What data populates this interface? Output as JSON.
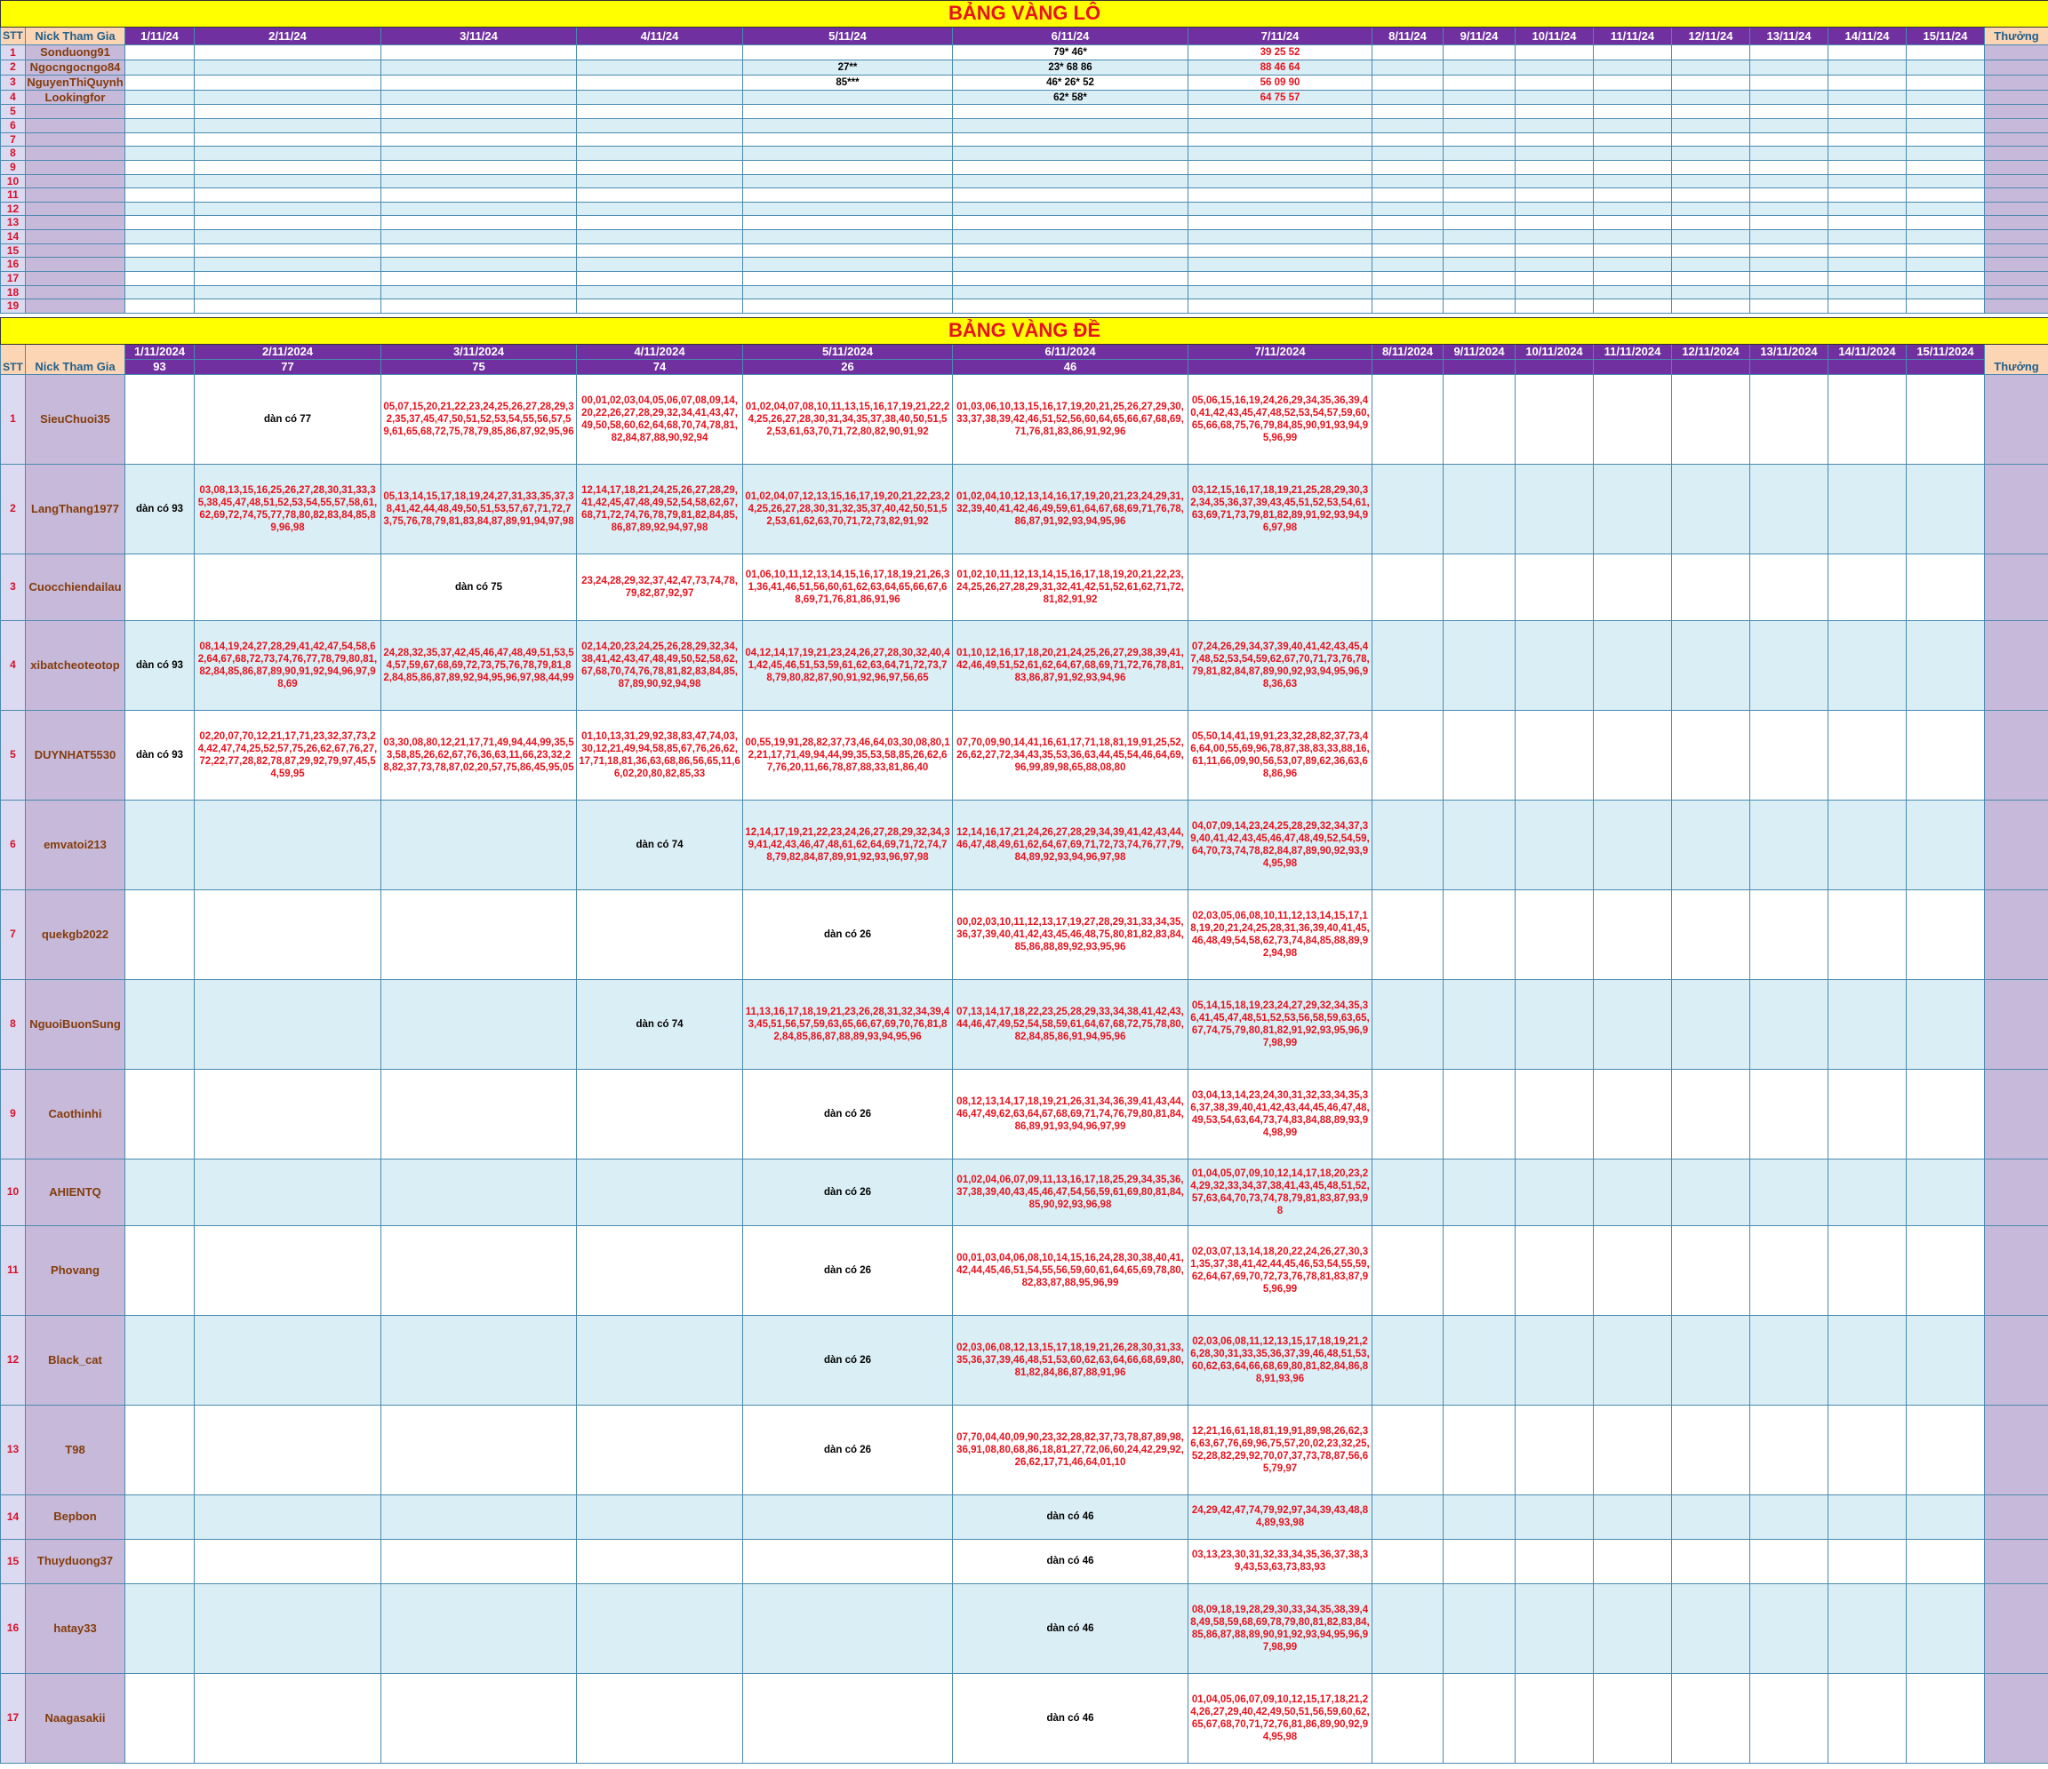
{
  "lo": {
    "title": "BẢNG VÀNG LÔ",
    "headers": [
      "STT",
      "Nick Tham Gia",
      "1/11/24",
      "2/11/24",
      "3/11/24",
      "4/11/24",
      "5/11/24",
      "6/11/24",
      "7/11/24",
      "8/11/24",
      "9/11/24",
      "10/11/24",
      "11/11/24",
      "12/11/24",
      "13/11/24",
      "14/11/24",
      "15/11/24",
      "Thưởng"
    ],
    "rows": [
      {
        "stt": "1",
        "nick": "Sonduong91",
        "cells": [
          "",
          "",
          "",
          "",
          "",
          "79* 46*",
          "39 25 52",
          "",
          "",
          "",
          "",
          "",
          "",
          "",
          ""
        ]
      },
      {
        "stt": "2",
        "nick": "Ngocngocngo84",
        "cells": [
          "",
          "",
          "",
          "",
          "27**",
          "23* 68 86",
          "88 46 64",
          "",
          "",
          "",
          "",
          "",
          "",
          "",
          ""
        ]
      },
      {
        "stt": "3",
        "nick": "NguyenThiQuynh",
        "cells": [
          "",
          "",
          "",
          "",
          "85***",
          "46* 26* 52",
          "56 09 90",
          "",
          "",
          "",
          "",
          "",
          "",
          "",
          ""
        ]
      },
      {
        "stt": "4",
        "nick": "Lookingfor",
        "cells": [
          "",
          "",
          "",
          "",
          "",
          "62* 58*",
          "64 75 57",
          "",
          "",
          "",
          "",
          "",
          "",
          "",
          ""
        ]
      },
      {
        "stt": "5",
        "nick": "",
        "cells": [
          "",
          "",
          "",
          "",
          "",
          "",
          "",
          "",
          "",
          "",
          "",
          "",
          "",
          "",
          ""
        ]
      },
      {
        "stt": "6",
        "nick": "",
        "cells": [
          "",
          "",
          "",
          "",
          "",
          "",
          "",
          "",
          "",
          "",
          "",
          "",
          "",
          "",
          ""
        ]
      },
      {
        "stt": "7",
        "nick": "",
        "cells": [
          "",
          "",
          "",
          "",
          "",
          "",
          "",
          "",
          "",
          "",
          "",
          "",
          "",
          "",
          ""
        ]
      },
      {
        "stt": "8",
        "nick": "",
        "cells": [
          "",
          "",
          "",
          "",
          "",
          "",
          "",
          "",
          "",
          "",
          "",
          "",
          "",
          "",
          ""
        ]
      },
      {
        "stt": "9",
        "nick": "",
        "cells": [
          "",
          "",
          "",
          "",
          "",
          "",
          "",
          "",
          "",
          "",
          "",
          "",
          "",
          "",
          ""
        ]
      },
      {
        "stt": "10",
        "nick": "",
        "cells": [
          "",
          "",
          "",
          "",
          "",
          "",
          "",
          "",
          "",
          "",
          "",
          "",
          "",
          "",
          ""
        ]
      },
      {
        "stt": "11",
        "nick": "",
        "cells": [
          "",
          "",
          "",
          "",
          "",
          "",
          "",
          "",
          "",
          "",
          "",
          "",
          "",
          "",
          ""
        ]
      },
      {
        "stt": "12",
        "nick": "",
        "cells": [
          "",
          "",
          "",
          "",
          "",
          "",
          "",
          "",
          "",
          "",
          "",
          "",
          "",
          "",
          ""
        ]
      },
      {
        "stt": "13",
        "nick": "",
        "cells": [
          "",
          "",
          "",
          "",
          "",
          "",
          "",
          "",
          "",
          "",
          "",
          "",
          "",
          "",
          ""
        ]
      },
      {
        "stt": "14",
        "nick": "",
        "cells": [
          "",
          "",
          "",
          "",
          "",
          "",
          "",
          "",
          "",
          "",
          "",
          "",
          "",
          "",
          ""
        ]
      },
      {
        "stt": "15",
        "nick": "",
        "cells": [
          "",
          "",
          "",
          "",
          "",
          "",
          "",
          "",
          "",
          "",
          "",
          "",
          "",
          "",
          ""
        ]
      },
      {
        "stt": "16",
        "nick": "",
        "cells": [
          "",
          "",
          "",
          "",
          "",
          "",
          "",
          "",
          "",
          "",
          "",
          "",
          "",
          "",
          ""
        ]
      },
      {
        "stt": "17",
        "nick": "",
        "cells": [
          "",
          "",
          "",
          "",
          "",
          "",
          "",
          "",
          "",
          "",
          "",
          "",
          "",
          "",
          ""
        ]
      },
      {
        "stt": "18",
        "nick": "",
        "cells": [
          "",
          "",
          "",
          "",
          "",
          "",
          "",
          "",
          "",
          "",
          "",
          "",
          "",
          "",
          ""
        ]
      },
      {
        "stt": "19",
        "nick": "",
        "cells": [
          "",
          "",
          "",
          "",
          "",
          "",
          "",
          "",
          "",
          "",
          "",
          "",
          "",
          "",
          ""
        ]
      }
    ]
  },
  "de": {
    "title": "BẢNG VÀNG ĐỀ",
    "dates": [
      "1/11/2024",
      "2/11/2024",
      "3/11/2024",
      "4/11/2024",
      "5/11/2024",
      "6/11/2024",
      "7/11/2024",
      "8/11/2024",
      "9/11/2024",
      "10/11/2024",
      "11/11/2024",
      "12/11/2024",
      "13/11/2024",
      "14/11/2024",
      "15/11/2024"
    ],
    "results": [
      "93",
      "77",
      "75",
      "74",
      "26",
      "46",
      "",
      "",
      "",
      "",
      "",
      "",
      "",
      "",
      ""
    ],
    "stt_label": "STT",
    "nick_label": "Nick Tham Gia",
    "thuong_label": "Thưởng",
    "rows": [
      {
        "stt": "1",
        "nick": "SieuChuoi35",
        "cells": [
          "",
          "dàn có 77",
          "05,07,15,20,21,22,23,24,25,26,27,28,29,32,35,37,45,47,50,51,52,53,54,55,56,57,59,61,65,68,72,75,78,79,85,86,87,92,95,96",
          "00,01,02,03,04,05,06,07,08,09,14,20,22,26,27,28,29,32,34,41,43,47,49,50,58,60,62,64,68,70,74,78,81,82,84,87,88,90,92,94",
          "01,02,04,07,08,10,11,13,15,16,17,19,21,22,24,25,26,27,28,30,31,34,35,37,38,40,50,51,52,53,61,63,70,71,72,80,82,90,91,92",
          "01,03,06,10,13,15,16,17,19,20,21,25,26,27,29,30,33,37,38,39,42,46,51,52,56,60,64,65,66,67,68,69,71,76,81,83,86,91,92,96",
          "05,06,15,16,19,24,26,29,34,35,36,39,40,41,42,43,45,47,48,52,53,54,57,59,60,65,66,68,75,76,79,84,85,90,91,93,94,95,96,99",
          "",
          "",
          "",
          "",
          "",
          "",
          "",
          ""
        ]
      },
      {
        "stt": "2",
        "nick": "LangThang1977",
        "cells": [
          "dàn có 93",
          "03,08,13,15,16,25,26,27,28,30,31,33,35,38,45,47,48,51,52,53,54,55,57,58,61,62,69,72,74,75,77,78,80,82,83,84,85,89,96,98",
          "05,13,14,15,17,18,19,24,27,31,33,35,37,38,41,42,44,48,49,50,51,53,57,67,71,72,73,75,76,78,79,81,83,84,87,89,91,94,97,98",
          "12,14,17,18,21,24,25,26,27,28,29,41,42,45,47,48,49,52,54,58,62,67,68,71,72,74,76,78,79,81,82,84,85,86,87,89,92,94,97,98",
          "01,02,04,07,12,13,15,16,17,19,20,21,22,23,24,25,26,27,28,30,31,32,35,37,40,42,50,51,52,53,61,62,63,70,71,72,73,82,91,92",
          "01,02,04,10,12,13,14,16,17,19,20,21,23,24,29,31,32,39,40,41,42,46,49,59,61,64,67,68,69,71,76,78,86,87,91,92,93,94,95,96",
          "03,12,15,16,17,18,19,21,25,28,29,30,32,34,35,36,37,39,43,45,51,52,53,54,61,63,69,71,73,79,81,82,89,91,92,93,94,96,97,98",
          "",
          "",
          "",
          "",
          "",
          "",
          "",
          ""
        ]
      },
      {
        "stt": "3",
        "nick": "Cuocchiendailau",
        "cells": [
          "",
          "",
          "dàn có 75",
          "23,24,28,29,32,37,42,47,73,74,78,79,82,87,92,97",
          "01,06,10,11,12,13,14,15,16,17,18,19,21,26,31,36,41,46,51,56,60,61,62,63,64,65,66,67,68,69,71,76,81,86,91,96",
          "01,02,10,11,12,13,14,15,16,17,18,19,20,21,22,23,24,25,26,27,28,29,31,32,41,42,51,52,61,62,71,72,81,82,91,92",
          "",
          "",
          "",
          "",
          "",
          "",
          "",
          "",
          ""
        ]
      },
      {
        "stt": "4",
        "nick": "xibatcheoteotop",
        "cells": [
          "dàn có 93",
          "08,14,19,24,27,28,29,41,42,47,54,58,62,64,67,68,72,73,74,76,77,78,79,80,81,82,84,85,86,87,89,90,91,92,94,96,97,98,69",
          "24,28,32,35,37,42,45,46,47,48,49,51,53,54,57,59,67,68,69,72,73,75,76,78,79,81,82,84,85,86,87,89,92,94,95,96,97,98,44,99",
          "02,14,20,23,24,25,26,28,29,32,34,38,41,42,43,47,48,49,50,52,58,62,67,68,70,74,76,78,81,82,83,84,85,87,89,90,92,94,98",
          "04,12,14,17,19,21,23,24,26,27,28,30,32,40,41,42,45,46,51,53,59,61,62,63,64,71,72,73,78,79,80,82,87,90,91,92,96,97,56,65",
          "01,10,12,16,17,18,20,21,24,25,26,27,29,38,39,41,42,46,49,51,52,61,62,64,67,68,69,71,72,76,78,81,83,86,87,91,92,93,94,96",
          "07,24,26,29,34,37,39,40,41,42,43,45,47,48,52,53,54,59,62,67,70,71,73,76,78,79,81,82,84,87,89,90,92,93,94,95,96,98,36,63",
          "",
          "",
          "",
          "",
          "",
          "",
          "",
          ""
        ]
      },
      {
        "stt": "5",
        "nick": "DUYNHAT5530",
        "cells": [
          "dàn có 93",
          "02,20,07,70,12,21,17,71,23,32,37,73,24,42,47,74,25,52,57,75,26,62,67,76,27,72,22,77,28,82,78,87,29,92,79,97,45,54,59,95",
          "03,30,08,80,12,21,17,71,49,94,44,99,35,53,58,85,26,62,67,76,36,63,11,66,23,32,28,82,37,73,78,87,02,20,57,75,86,45,95,05",
          "01,10,13,31,29,92,38,83,47,74,03,30,12,21,49,94,58,85,67,76,26,62,17,71,18,81,36,63,68,86,56,65,11,66,02,20,80,82,85,33",
          "00,55,19,91,28,82,37,73,46,64,03,30,08,80,12,21,17,71,49,94,44,99,35,53,58,85,26,62,67,76,20,11,66,78,87,88,33,81,86,40",
          "07,70,09,90,14,41,16,61,17,71,18,81,19,91,25,52,26,62,27,72,34,43,35,53,36,63,44,45,54,46,64,69,96,99,89,98,65,88,08,80",
          "05,50,14,41,19,91,23,32,28,82,37,73,46,64,00,55,69,96,78,87,38,83,33,88,16,61,11,66,09,90,56,53,07,89,62,36,63,68,86,96",
          "",
          "",
          "",
          "",
          "",
          "",
          "",
          ""
        ]
      },
      {
        "stt": "6",
        "nick": "emvatoi213",
        "cells": [
          "",
          "",
          "",
          "dàn có 74",
          "12,14,17,19,21,22,23,24,26,27,28,29,32,34,39,41,42,43,46,47,48,61,62,64,69,71,72,74,78,79,82,84,87,89,91,92,93,96,97,98",
          "12,14,16,17,21,24,26,27,28,29,34,39,41,42,43,44,46,47,48,49,61,62,64,67,69,71,72,73,74,76,77,79,84,89,92,93,94,96,97,98",
          "04,07,09,14,23,24,25,28,29,32,34,37,39,40,41,42,43,45,46,47,48,49,52,54,59,64,70,73,74,78,82,84,87,89,90,92,93,94,95,98",
          "",
          "",
          "",
          "",
          "",
          "",
          "",
          ""
        ]
      },
      {
        "stt": "7",
        "nick": "quekgb2022",
        "cells": [
          "",
          "",
          "",
          "",
          "dàn có 26",
          "00,02,03,10,11,12,13,17,19,27,28,29,31,33,34,35,36,37,39,40,41,42,43,45,46,48,75,80,81,82,83,84,85,86,88,89,92,93,95,96",
          "02,03,05,06,08,10,11,12,13,14,15,17,18,19,20,21,24,25,28,31,36,39,40,41,45,46,48,49,54,58,62,73,74,84,85,88,89,92,94,98",
          "",
          "",
          "",
          "",
          "",
          "",
          "",
          ""
        ]
      },
      {
        "stt": "8",
        "nick": "NguoiBuonSung",
        "cells": [
          "",
          "",
          "",
          "dàn có 74",
          "11,13,16,17,18,19,21,23,26,28,31,32,34,39,43,45,51,56,57,59,63,65,66,67,69,70,76,81,82,84,85,86,87,88,89,93,94,95,96",
          "07,13,14,17,18,22,23,25,28,29,33,34,38,41,42,43,44,46,47,49,52,54,58,59,61,64,67,68,72,75,78,80,82,84,85,86,91,94,95,96",
          "05,14,15,18,19,23,24,27,29,32,34,35,36,41,45,47,48,51,52,53,56,58,59,63,65,67,74,75,79,80,81,82,91,92,93,95,96,97,98,99",
          "",
          "",
          "",
          "",
          "",
          "",
          "",
          ""
        ]
      },
      {
        "stt": "9",
        "nick": "Caothinhi",
        "cells": [
          "",
          "",
          "",
          "",
          "dàn có 26",
          "08,12,13,14,17,18,19,21,26,31,34,36,39,41,43,44,46,47,49,62,63,64,67,68,69,71,74,76,79,80,81,84,86,89,91,93,94,96,97,99",
          "03,04,13,14,23,24,30,31,32,33,34,35,36,37,38,39,40,41,42,43,44,45,46,47,48,49,53,54,63,64,73,74,83,84,88,89,93,94,98,99",
          "",
          "",
          "",
          "",
          "",
          "",
          "",
          ""
        ]
      },
      {
        "stt": "10",
        "nick": "AHIENTQ",
        "cells": [
          "",
          "",
          "",
          "",
          "dàn có 26",
          "01,02,04,06,07,09,11,13,16,17,18,25,29,34,35,36,37,38,39,40,43,45,46,47,54,56,59,61,69,80,81,84,85,90,92,93,96,98",
          "01,04,05,07,09,10,12,14,17,18,20,23,24,29,32,33,34,37,38,41,43,45,48,51,52,57,63,64,70,73,74,78,79,81,83,87,93,98",
          "",
          "",
          "",
          "",
          "",
          "",
          "",
          ""
        ]
      },
      {
        "stt": "11",
        "nick": "Phovang",
        "cells": [
          "",
          "",
          "",
          "",
          "dàn có 26",
          "00,01,03,04,06,08,10,14,15,16,24,28,30,38,40,41,42,44,45,46,51,54,55,56,59,60,61,64,65,69,78,80,82,83,87,88,95,96,99",
          "02,03,07,13,14,18,20,22,24,26,27,30,31,35,37,38,41,42,44,45,46,53,54,55,59,62,64,67,69,70,72,73,76,78,81,83,87,95,96,99",
          "",
          "",
          "",
          "",
          "",
          "",
          "",
          ""
        ]
      },
      {
        "stt": "12",
        "nick": "Black_cat",
        "cells": [
          "",
          "",
          "",
          "",
          "dàn có 26",
          "02,03,06,08,12,13,15,17,18,19,21,26,28,30,31,33,35,36,37,39,46,48,51,53,60,62,63,64,66,68,69,80,81,82,84,86,87,88,91,96",
          "02,03,06,08,11,12,13,15,17,18,19,21,26,28,30,31,33,35,36,37,39,46,48,51,53,60,62,63,64,66,68,69,80,81,82,84,86,88,91,93,96",
          "",
          "",
          "",
          "",
          "",
          "",
          "",
          ""
        ]
      },
      {
        "stt": "13",
        "nick": "T98",
        "cells": [
          "",
          "",
          "",
          "",
          "dàn có 26",
          "07,70,04,40,09,90,23,32,28,82,37,73,78,87,89,98,36,91,08,80,68,86,18,81,27,72,06,60,24,42,29,92,26,62,17,71,46,64,01,10",
          "12,21,16,61,18,81,19,91,89,98,26,62,36,63,67,76,69,96,75,57,20,02,23,32,25,52,28,82,29,92,70,07,37,73,78,87,56,65,79,97",
          "",
          "",
          "",
          "",
          "",
          "",
          "",
          ""
        ]
      },
      {
        "stt": "14",
        "nick": "Bepbon",
        "cells": [
          "",
          "",
          "",
          "",
          "",
          "dàn có 46",
          "24,29,42,47,74,79,92,97,34,39,43,48,84,89,93,98",
          "",
          "",
          "",
          "",
          "",
          "",
          "",
          ""
        ]
      },
      {
        "stt": "15",
        "nick": "Thuyduong37",
        "cells": [
          "",
          "",
          "",
          "",
          "",
          "dàn có 46",
          "03,13,23,30,31,32,33,34,35,36,37,38,39,43,53,63,73,83,93",
          "",
          "",
          "",
          "",
          "",
          "",
          "",
          ""
        ]
      },
      {
        "stt": "16",
        "nick": "hatay33",
        "cells": [
          "",
          "",
          "",
          "",
          "",
          "dàn có 46",
          "08,09,18,19,28,29,30,33,34,35,38,39,48,49,58,59,68,69,78,79,80,81,82,83,84,85,86,87,88,89,90,91,92,93,94,95,96,97,98,99",
          "",
          "",
          "",
          "",
          "",
          "",
          "",
          ""
        ]
      },
      {
        "stt": "17",
        "nick": "Naagasakii",
        "cells": [
          "",
          "",
          "",
          "",
          "",
          "dàn có 46",
          "01,04,05,06,07,09,10,12,15,17,18,21,24,26,27,29,40,42,49,50,51,56,59,60,62,65,67,68,70,71,72,76,81,86,89,90,92,94,95,98",
          "",
          "",
          "",
          "",
          "",
          "",
          "",
          ""
        ]
      }
    ]
  }
}
